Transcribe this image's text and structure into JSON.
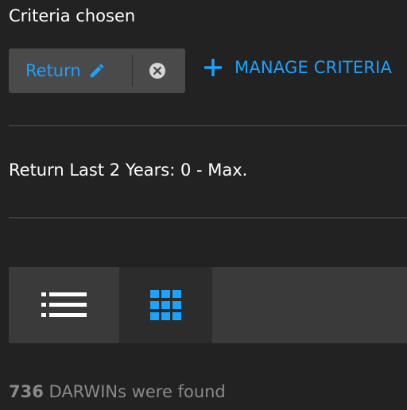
{
  "criteria": {
    "title": "Criteria chosen",
    "chip_label": "Return",
    "manage_label": "MANAGE CRITERIA",
    "summary_line": "Return Last 2 Years: 0 - Max."
  },
  "view_toggle": {
    "list_icon": "list-icon",
    "grid_icon": "grid-icon",
    "selected": "grid"
  },
  "results": {
    "count": "736",
    "text": " DARWINs were found"
  },
  "colors": {
    "accent": "#1aa3ff",
    "background": "#222222",
    "chip_bg": "#4a4a4a",
    "muted_text": "#8a8a8a"
  }
}
